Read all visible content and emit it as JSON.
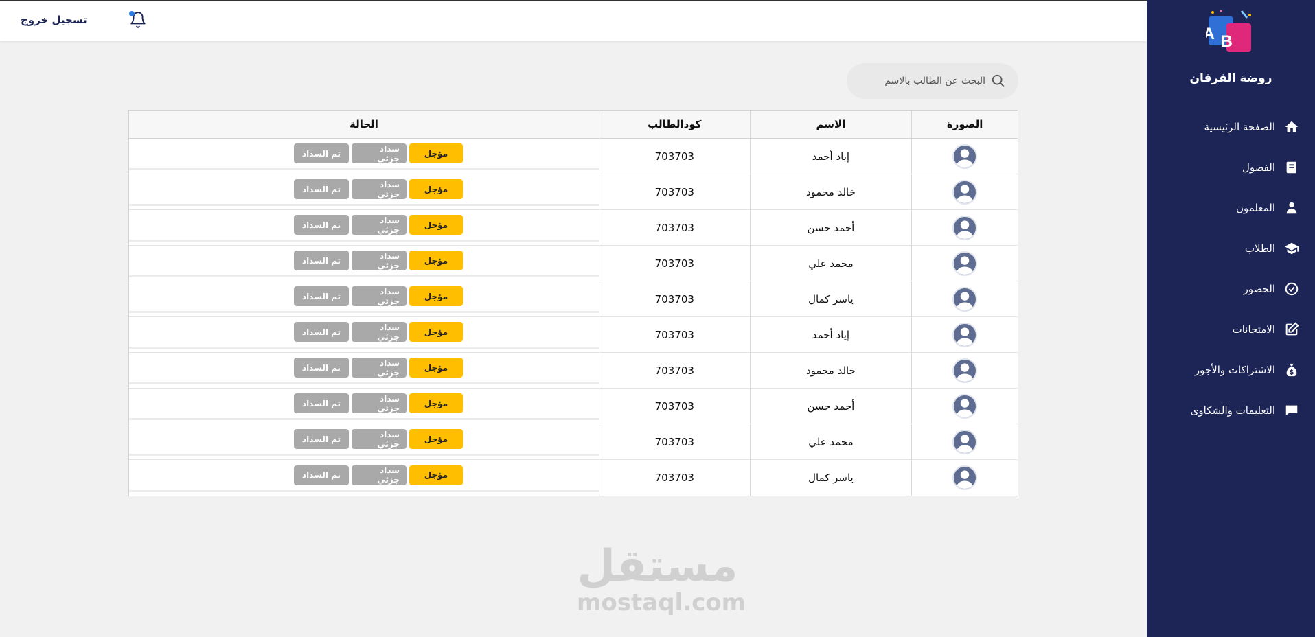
{
  "topbar": {
    "logout_label": "تسجيل خروج"
  },
  "sidebar": {
    "school_name": "روضة الفرقان",
    "items": [
      {
        "label": "الصفحة الرئيسية",
        "icon": "home-icon"
      },
      {
        "label": "الفصول",
        "icon": "book-icon"
      },
      {
        "label": "المعلمون",
        "icon": "teacher-icon"
      },
      {
        "label": "الطلاب",
        "icon": "graduation-cap-icon"
      },
      {
        "label": "الحضور",
        "icon": "check-circle-icon"
      },
      {
        "label": "الامتحانات",
        "icon": "edit-icon"
      },
      {
        "label": "الاشتراكات والأجور",
        "icon": "money-bag-icon"
      },
      {
        "label": "التعليمات والشكاوى",
        "icon": "chat-icon"
      }
    ]
  },
  "search": {
    "placeholder": "البحث عن الطالب بالاسم"
  },
  "table": {
    "headers": {
      "photo": "الصورة",
      "name": "الاسم",
      "code": "كودالطالب",
      "status": "الحالة"
    },
    "buttons": {
      "deferred": "مؤجل",
      "partial": "سداد جزئي",
      "paid": "تم السداد"
    },
    "rows": [
      {
        "name": "إياد أحمد",
        "code": "703703"
      },
      {
        "name": "خالد محمود",
        "code": "703703"
      },
      {
        "name": "أحمد حسن",
        "code": "703703"
      },
      {
        "name": "محمد علي",
        "code": "703703"
      },
      {
        "name": "ياسر كمال",
        "code": "703703"
      },
      {
        "name": "إياد أحمد",
        "code": "703703"
      },
      {
        "name": "خالد محمود",
        "code": "703703"
      },
      {
        "name": "أحمد حسن",
        "code": "703703"
      },
      {
        "name": "محمد علي",
        "code": "703703"
      },
      {
        "name": "ياسر كمال",
        "code": "703703"
      }
    ]
  },
  "watermark": {
    "arabic": "مستقل",
    "latin": "mostaql.com"
  },
  "colors": {
    "sidebar_bg": "#1c2556",
    "deferred_button": "#ffbf00",
    "inactive_button": "#a9a9a9",
    "notification_dot": "#2f7de1"
  }
}
